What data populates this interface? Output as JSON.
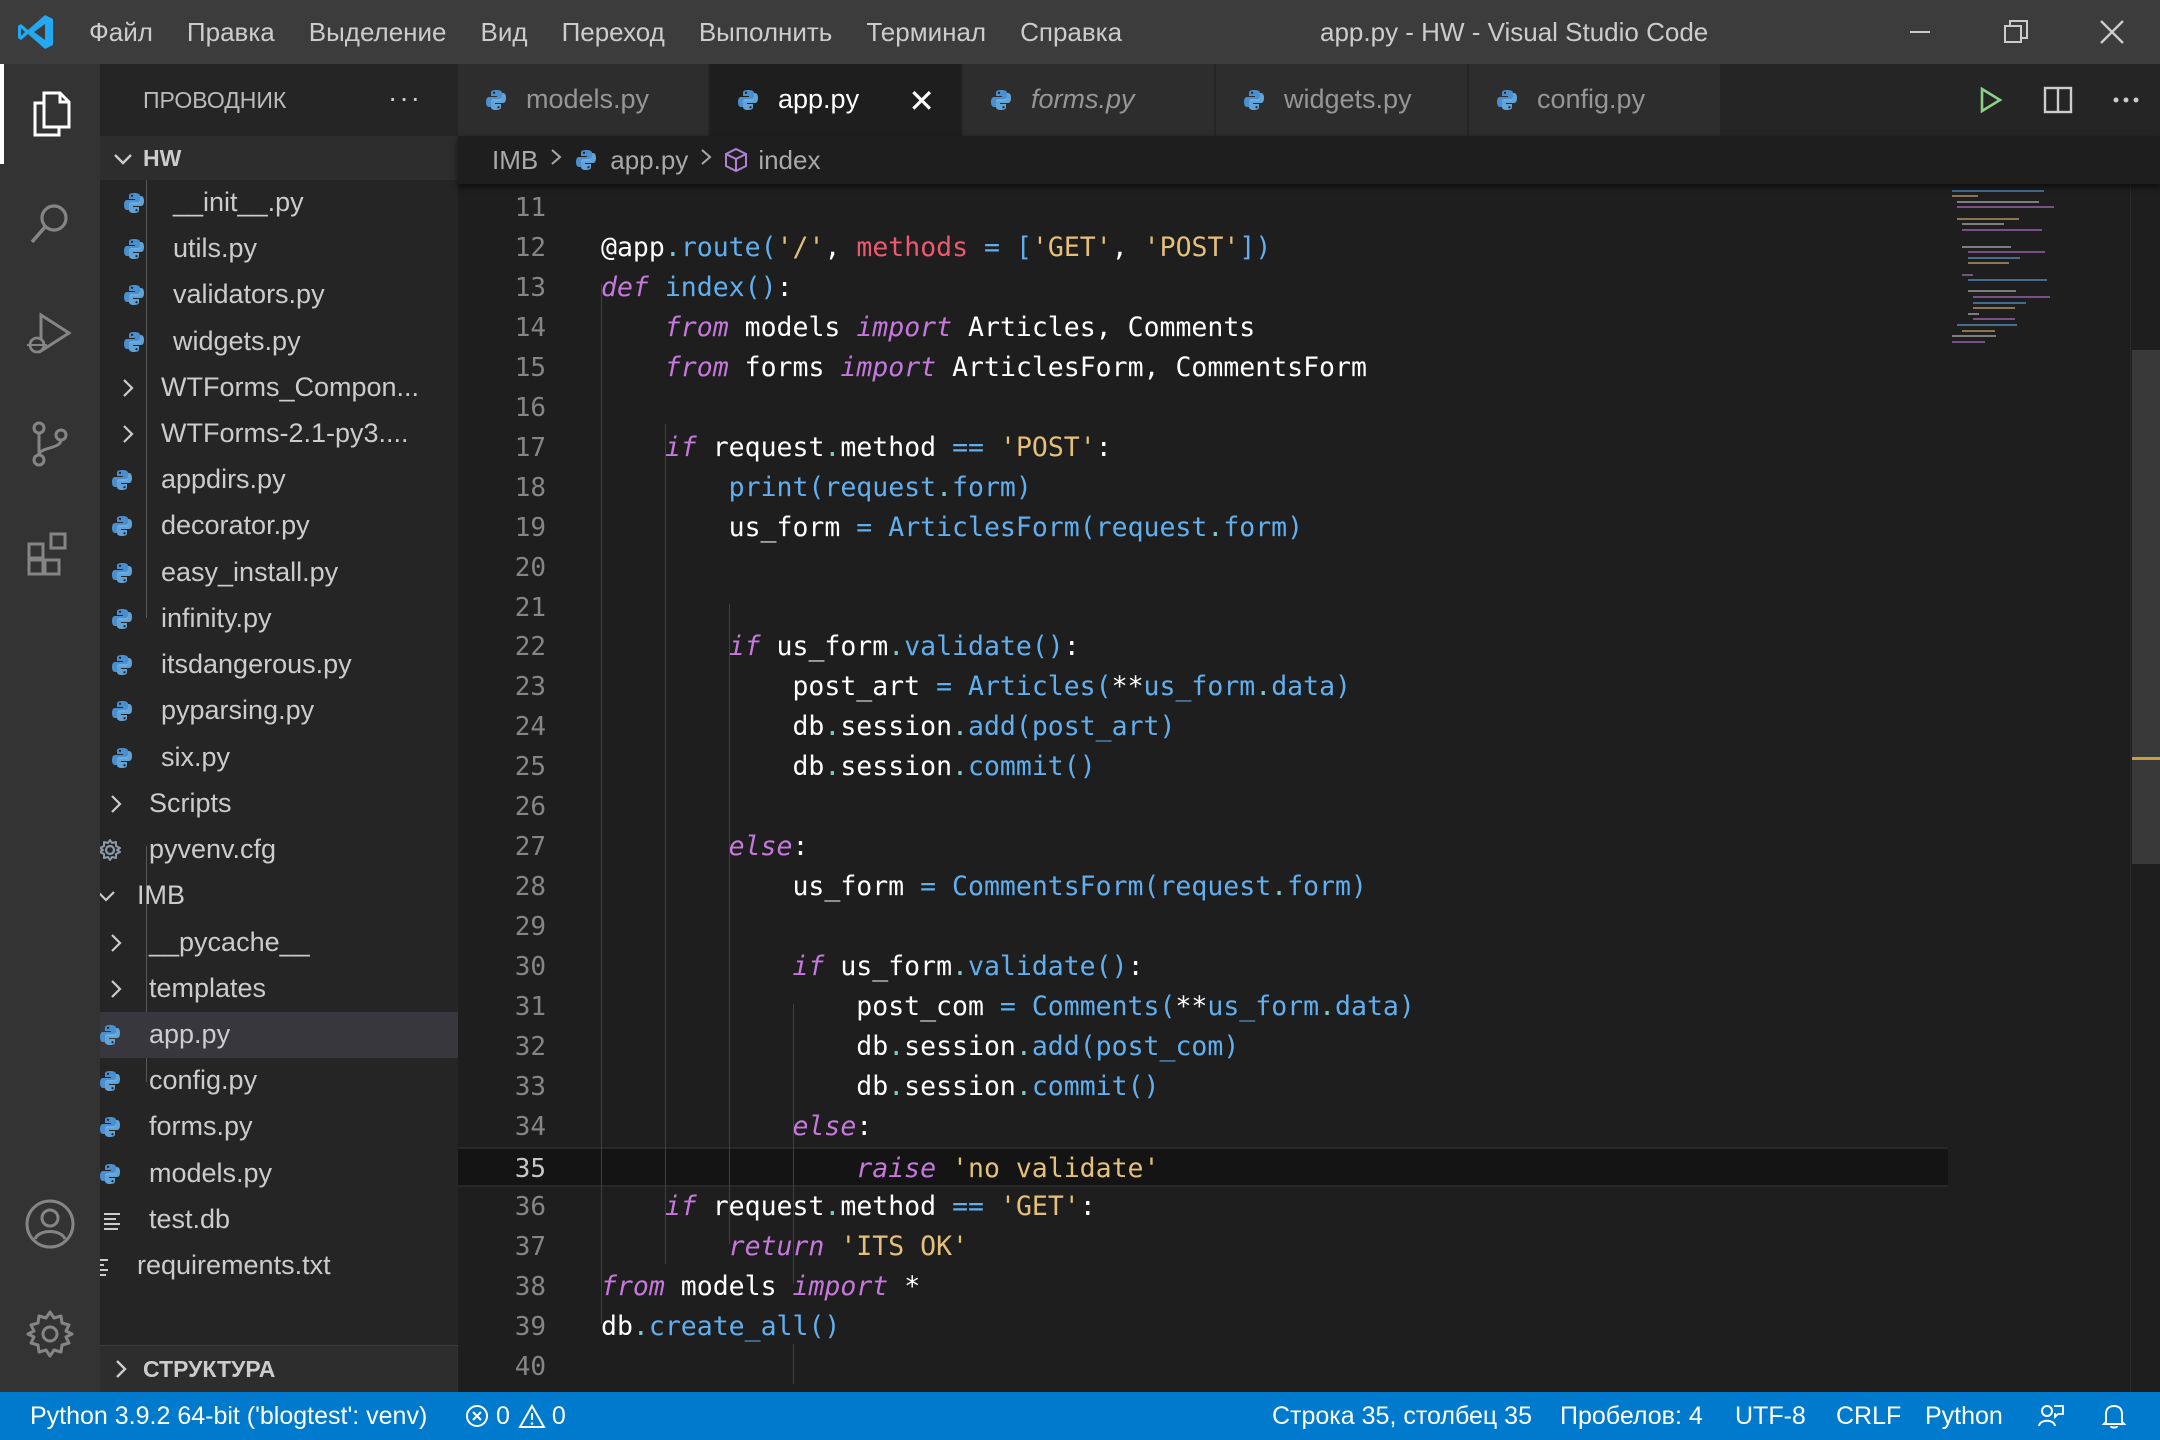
{
  "window": {
    "title": "app.py - HW - Visual Studio Code",
    "menu": [
      "Файл",
      "Правка",
      "Выделение",
      "Вид",
      "Переход",
      "Выполнить",
      "Терминал",
      "Справка"
    ]
  },
  "activity_bar": [
    "explorer-icon",
    "search-icon",
    "run-debug-icon",
    "source-control-icon",
    "extensions-icon",
    "accounts-icon",
    "settings-gear-icon"
  ],
  "sidebar": {
    "header": "ПРОВОДНИК",
    "more": "···",
    "section": "HW",
    "items": [
      {
        "label": "__init__.py",
        "type": "py"
      },
      {
        "label": "utils.py",
        "type": "py"
      },
      {
        "label": "validators.py",
        "type": "py"
      },
      {
        "label": "widgets.py",
        "type": "py"
      },
      {
        "label": "WTForms_Compon...",
        "type": "folder"
      },
      {
        "label": "WTForms-2.1-py3....",
        "type": "folder"
      },
      {
        "label": "appdirs.py",
        "type": "py"
      },
      {
        "label": "decorator.py",
        "type": "py"
      },
      {
        "label": "easy_install.py",
        "type": "py"
      },
      {
        "label": "infinity.py",
        "type": "py"
      },
      {
        "label": "itsdangerous.py",
        "type": "py"
      },
      {
        "label": "pyparsing.py",
        "type": "py"
      },
      {
        "label": "six.py",
        "type": "py"
      },
      {
        "label": "Scripts",
        "type": "folder"
      },
      {
        "label": "pyvenv.cfg",
        "type": "cfg"
      },
      {
        "label": "IMB",
        "type": "folder-open"
      },
      {
        "label": "__pycache__",
        "type": "folder"
      },
      {
        "label": "templates",
        "type": "folder"
      },
      {
        "label": "app.py",
        "type": "py"
      },
      {
        "label": "config.py",
        "type": "py"
      },
      {
        "label": "forms.py",
        "type": "py"
      },
      {
        "label": "models.py",
        "type": "py"
      },
      {
        "label": "test.db",
        "type": "txt"
      },
      {
        "label": "requirements.txt",
        "type": "txt"
      }
    ],
    "outline": "СТРУКТУРА"
  },
  "tabs": [
    {
      "label": "models.py"
    },
    {
      "label": "app.py",
      "close": "✕"
    },
    {
      "label": "forms.py"
    },
    {
      "label": "widgets.py"
    },
    {
      "label": "config.py"
    }
  ],
  "editor_actions": [
    "run-icon",
    "split-editor-icon",
    "more-actions-icon"
  ],
  "breadcrumbs": [
    "IMB",
    "app.py",
    "index"
  ],
  "editor": {
    "current_line": 35,
    "lines": [
      {
        "n": "11",
        "code": ""
      },
      {
        "n": "12",
        "code": "@app.route('/', methods = ['GET', 'POST'])"
      },
      {
        "n": "13",
        "code": "def index():"
      },
      {
        "n": "14",
        "code": "    from models import Articles, Comments"
      },
      {
        "n": "15",
        "code": "    from forms import ArticlesForm, CommentsForm"
      },
      {
        "n": "16",
        "code": ""
      },
      {
        "n": "17",
        "code": "    if request.method == 'POST':"
      },
      {
        "n": "18",
        "code": "        print(request.form)"
      },
      {
        "n": "19",
        "code": "        us_form = ArticlesForm(request.form)"
      },
      {
        "n": "20",
        "code": ""
      },
      {
        "n": "21",
        "code": ""
      },
      {
        "n": "22",
        "code": "        if us_form.validate():"
      },
      {
        "n": "23",
        "code": "            post_art = Articles(**us_form.data)"
      },
      {
        "n": "24",
        "code": "            db.session.add(post_art)"
      },
      {
        "n": "25",
        "code": "            db.session.commit()"
      },
      {
        "n": "26",
        "code": ""
      },
      {
        "n": "27",
        "code": "        else:"
      },
      {
        "n": "28",
        "code": "            us_form = CommentsForm(request.form)"
      },
      {
        "n": "29",
        "code": ""
      },
      {
        "n": "30",
        "code": "            if us_form.validate():"
      },
      {
        "n": "31",
        "code": "                post_com = Comments(**us_form.data)"
      },
      {
        "n": "32",
        "code": "                db.session.add(post_com)"
      },
      {
        "n": "33",
        "code": "                db.session.commit()"
      },
      {
        "n": "34",
        "code": "            else:"
      },
      {
        "n": "35",
        "code": "                raise 'no validate'"
      },
      {
        "n": "36",
        "code": "    if request.method == 'GET':"
      },
      {
        "n": "37",
        "code": "        return 'ITS OK'"
      },
      {
        "n": "38",
        "code": "from models import *"
      },
      {
        "n": "39",
        "code": "db.create_all()"
      },
      {
        "n": "40",
        "code": ""
      }
    ]
  },
  "status_bar": {
    "interpreter": "Python 3.9.2 64-bit ('blogtest': venv)",
    "errors": "0",
    "warnings": "0",
    "position": "Строка 35, столбец 35",
    "indent": "Пробелов: 4",
    "encoding": "UTF-8",
    "eol": "CRLF",
    "language": "Python"
  },
  "colors": {
    "accent": "#007acc",
    "keyword": "#c678dd",
    "string": "#e5c07b",
    "function": "#61afef",
    "parameter": "#ef596f"
  }
}
